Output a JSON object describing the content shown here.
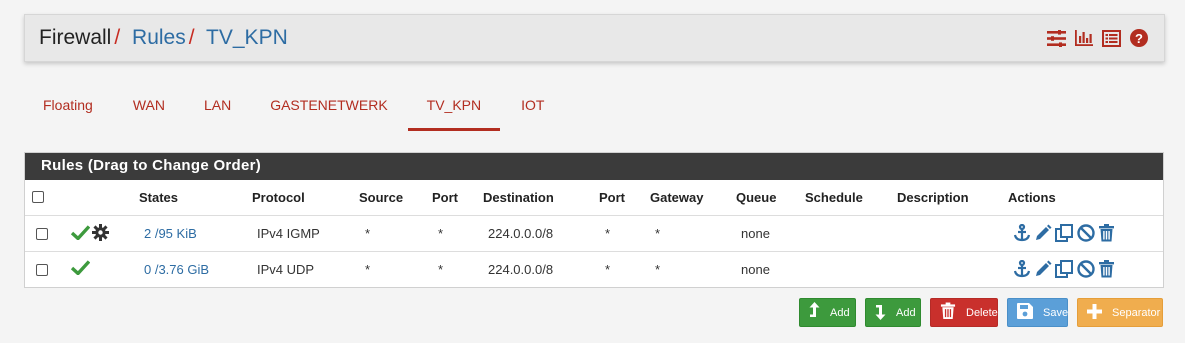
{
  "breadcrumb": {
    "root": "Firewall",
    "separator": "/",
    "level1": "Rules",
    "level2": "TV_KPN"
  },
  "header_icons": [
    "sliders-icon",
    "bar-chart-icon",
    "list-icon",
    "help-icon"
  ],
  "tabs": [
    {
      "label": "Floating",
      "active": false
    },
    {
      "label": "WAN",
      "active": false
    },
    {
      "label": "LAN",
      "active": false
    },
    {
      "label": "GASTENETWERK",
      "active": false
    },
    {
      "label": "TV_KPN",
      "active": true
    },
    {
      "label": "IOT",
      "active": false
    }
  ],
  "panel": {
    "title": "Rules (Drag to Change Order)"
  },
  "table": {
    "headers": {
      "states": "States",
      "protocol": "Protocol",
      "source": "Source",
      "port": "Port",
      "destination": "Destination",
      "port2": "Port",
      "gateway": "Gateway",
      "queue": "Queue",
      "schedule": "Schedule",
      "description": "Description",
      "actions": "Actions"
    },
    "rows": [
      {
        "enabled_icon": "check-icon",
        "advanced_icon": "gear-icon",
        "states": "2 /95 KiB",
        "protocol": "IPv4 IGMP",
        "source": "*",
        "port": "*",
        "destination": "224.0.0.0/8",
        "dest_port": "*",
        "gateway": "*",
        "queue": "none",
        "schedule": "",
        "description": ""
      },
      {
        "enabled_icon": "check-icon",
        "states": "0 /3.76 GiB",
        "protocol": "IPv4 UDP",
        "source": "*",
        "port": "*",
        "destination": "224.0.0.0/8",
        "dest_port": "*",
        "gateway": "*",
        "queue": "none",
        "schedule": "",
        "description": ""
      }
    ]
  },
  "buttons": {
    "add_top": "Add",
    "add_bottom": "Add",
    "delete": "Delete",
    "save": "Save",
    "separator": "Separator"
  },
  "colors": {
    "accent_red": "#b22d20",
    "link_blue": "#2d6ca3",
    "check_green": "#3d9a3d",
    "panel_head": "#3b3b3b"
  }
}
